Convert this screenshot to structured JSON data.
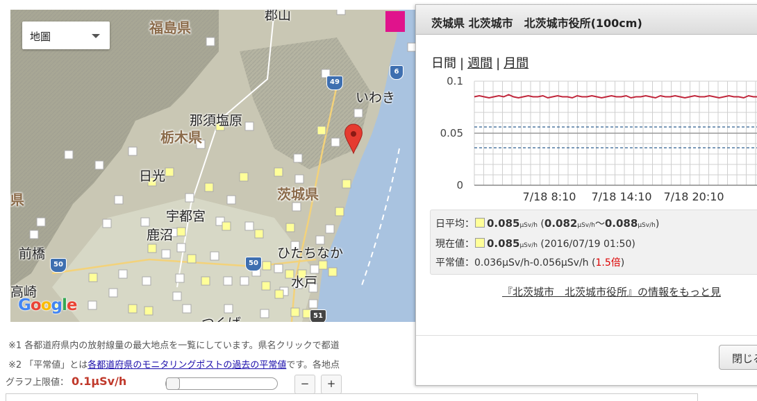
{
  "map": {
    "map_type_select": "地圖",
    "google_logo": [
      "G",
      "o",
      "o",
      "g",
      "l",
      "e"
    ],
    "prefectures": [
      {
        "name": "福島県",
        "key": "fukushima"
      },
      {
        "name": "栃木県",
        "key": "tochigi"
      },
      {
        "name": "茨城県",
        "key": "ibaraki"
      },
      {
        "name": "県",
        "key": "gunma-partial"
      }
    ],
    "cities": [
      {
        "name": "郡山",
        "key": "koriyama"
      },
      {
        "name": "いわき",
        "key": "iwaki"
      },
      {
        "name": "那須塩原",
        "key": "nasushiobara"
      },
      {
        "name": "日光",
        "key": "nikko"
      },
      {
        "name": "宇都宮",
        "key": "utsunomiya"
      },
      {
        "name": "鹿沼",
        "key": "kanuma"
      },
      {
        "name": "ひたちなか",
        "key": "hitachinaka"
      },
      {
        "name": "水戸",
        "key": "mito"
      },
      {
        "name": "前橋",
        "key": "maebashi"
      },
      {
        "name": "高崎",
        "key": "takasaki"
      },
      {
        "name": "つくば",
        "key": "tsukuba"
      }
    ],
    "route_shields": [
      "49",
      "6",
      "50",
      "50",
      "51"
    ]
  },
  "notes": {
    "note1": "※1 各都道府県内の放射線量の最大地点を一覧にしています。県名クリックで都道",
    "note2_prefix": "※2 「平常値」とは",
    "note2_link1": "各都道府県",
    "note2_link2": "のモニタリングポストの過去の平常値",
    "note2_suffix": "です。各地点"
  },
  "graph_limit": {
    "label": "グラフ上限値：",
    "value": "0.1μSv/h",
    "minus": "−",
    "plus": "+"
  },
  "dialog": {
    "title": "茨城県 北茨城市　北茨城市役所(100cm)",
    "periods": [
      "日間",
      "週間",
      "月間"
    ],
    "separator": "|",
    "stats": {
      "daily_avg_label": "日平均：",
      "daily_avg_value": "0.085",
      "daily_range_open": "(",
      "daily_min": "0.082",
      "daily_tilde": "〜",
      "daily_max": "0.088",
      "daily_range_close": ")",
      "unit": "μSv/h",
      "current_label": "現在値：",
      "current_value": "0.085",
      "current_time": "(2016/07/19 01:50)",
      "normal_label": "平常値：",
      "normal_range": "0.036μSv/h-0.056μSv/h",
      "ratio_open": "(",
      "ratio_value": "1.5倍",
      "ratio_close": ")"
    },
    "more_info": "『北茨城市　北茨城市役所』の情報をもっと見",
    "close_button": "閉じる"
  },
  "chart_data": {
    "type": "line",
    "y_ticks": [
      "0.1",
      "0.05",
      "0"
    ],
    "x_ticks": [
      "7/18 8:10",
      "7/18 14:10",
      "7/18 20:10"
    ],
    "ylim": [
      0,
      0.1
    ],
    "normal_range": [
      0.036,
      0.056
    ],
    "series": [
      {
        "values": [
          0.085,
          0.086,
          0.085,
          0.084,
          0.085,
          0.086,
          0.085,
          0.087,
          0.085,
          0.084,
          0.085,
          0.086,
          0.085,
          0.085,
          0.086,
          0.084,
          0.085,
          0.086,
          0.085,
          0.085,
          0.084,
          0.086,
          0.085,
          0.085,
          0.086,
          0.085,
          0.084,
          0.085,
          0.086,
          0.085,
          0.085,
          0.086,
          0.084,
          0.085,
          0.085,
          0.086,
          0.085,
          0.084,
          0.086,
          0.085,
          0.085,
          0.086,
          0.085,
          0.084,
          0.085,
          0.086,
          0.085,
          0.085,
          0.086,
          0.085,
          0.084,
          0.085,
          0.086,
          0.085,
          0.085,
          0.084,
          0.086,
          0.085,
          0.085,
          0.086
        ]
      }
    ],
    "colors": {
      "line": "#c0253a",
      "normal_line": "#2c5d8f",
      "grid": "#cfcfcf"
    }
  }
}
